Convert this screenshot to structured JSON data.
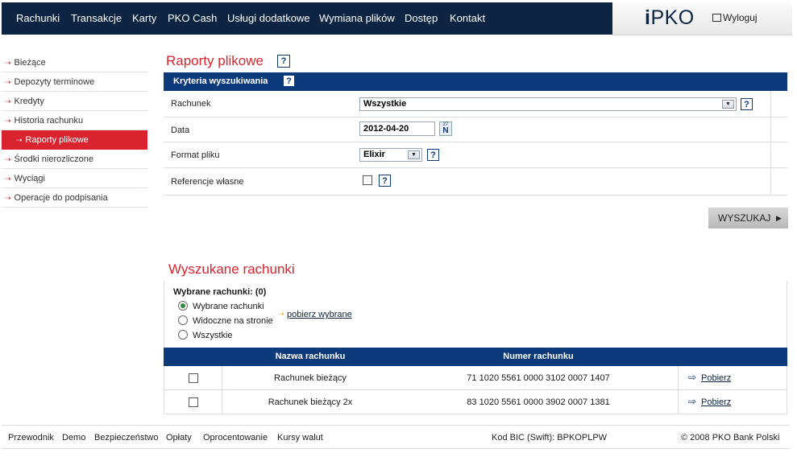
{
  "topnav": {
    "items": [
      "Rachunki",
      "Transakcje",
      "Karty",
      "PKO Cash",
      "Usługi dodatkowe",
      "Wymiana plików",
      "Dostęp",
      "Kontakt"
    ]
  },
  "brand": {
    "logo_i": "i",
    "logo_text": "PKO",
    "logout": "Wyloguj"
  },
  "sidebar": {
    "items": [
      {
        "label": "Bieżące"
      },
      {
        "label": "Depozyty terminowe"
      },
      {
        "label": "Kredyty"
      },
      {
        "label": "Historia rachunku"
      },
      {
        "label": "Raporty plikowe",
        "active": true
      },
      {
        "label": "Środki nierozliczone"
      },
      {
        "label": "Wyciągi"
      },
      {
        "label": "Operacje do podpisania"
      }
    ]
  },
  "page": {
    "title": "Raporty plikowe",
    "help": "?",
    "criteria_title": "Kryteria wyszukiwania",
    "fields": {
      "account_label": "Rachunek",
      "account_value": "Wszystkie",
      "date_label": "Data",
      "date_value": "2012-04-20",
      "calendar_top": "27",
      "calendar_letter": "N",
      "format_label": "Format pliku",
      "format_value": "Elixir",
      "ref_label": "Referencje własne"
    },
    "search_button": "WYSZUKAJ"
  },
  "results": {
    "title": "Wyszukane rachunki",
    "selected_label": "Wybrane rachunki: (0)",
    "options": [
      "Wybrane rachunki",
      "Widoczne na stronie",
      "Wszystkie"
    ],
    "download_selected": "pobierz wybrane",
    "columns": [
      "Nazwa rachunku",
      "Numer rachunku"
    ],
    "rows": [
      {
        "name": "Rachunek bieżący",
        "number": "71 1020 5561 0000 3102 0007 1407",
        "action": "Pobierz"
      },
      {
        "name": "Rachunek bieżący 2x",
        "number": "83 1020 5561 0000 3902 0007 1381",
        "action": "Pobierz"
      }
    ]
  },
  "footer": {
    "links": [
      "Przewodnik",
      "Demo",
      "Bezpieczeństwo",
      "Opłaty",
      "Oprocentowanie",
      "Kursy walut"
    ],
    "bic": "Kod BIC (Swift): BPKOPLPW",
    "copyright": "© 2008 PKO Bank Polski"
  },
  "colors": {
    "navy": "#0d2442",
    "bar": "#0d3a7a",
    "red": "#d9232e"
  }
}
